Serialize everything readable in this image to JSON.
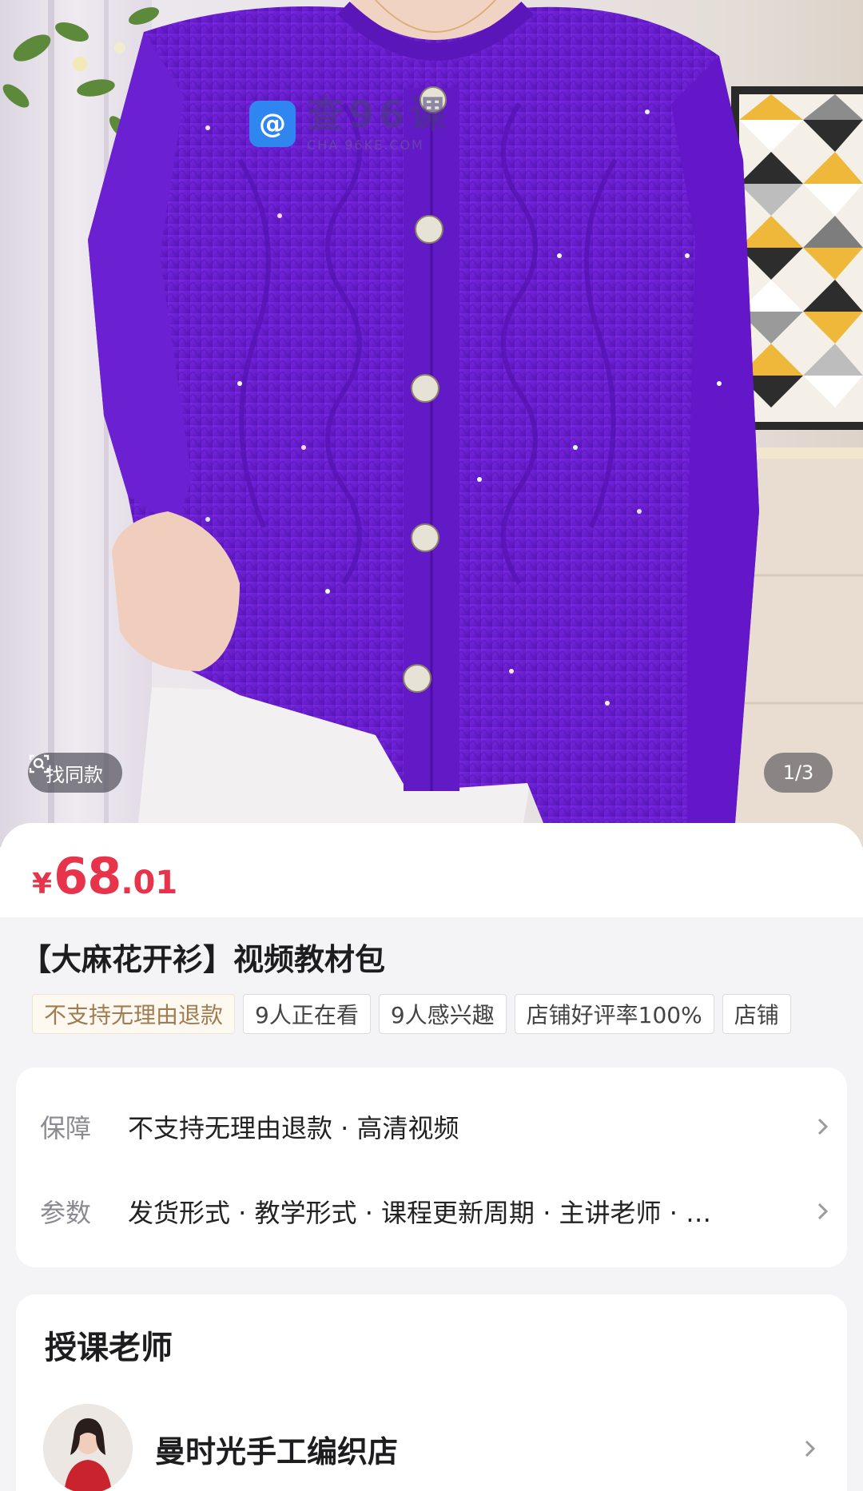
{
  "gallery": {
    "watermark_text": "查96课",
    "watermark_url": "CHA 96KE.COM",
    "find_same_label": "找同款",
    "page_indicator": "1/3"
  },
  "product": {
    "price_symbol": "¥",
    "price_integer": "68",
    "price_decimal": ".01",
    "title": "【大麻花开衫】视频教材包",
    "tags": [
      "不支持无理由退款",
      "9人正在看",
      "9人感兴趣",
      "店铺好评率100%",
      "店铺"
    ]
  },
  "info": {
    "guarantee_key": "保障",
    "guarantee_value": "不支持无理由退款 · 高清视频",
    "params_key": "参数",
    "params_value": "发货形式 · 教学形式 · 课程更新周期 · 主讲老师 · …"
  },
  "teacher": {
    "section_title": "授课老师",
    "name": "曼时光手工编织店"
  },
  "colors": {
    "price_red": "#e8344a",
    "sweater_purple": "#6a1fd0",
    "watermark_blue": "#2f86f0"
  }
}
